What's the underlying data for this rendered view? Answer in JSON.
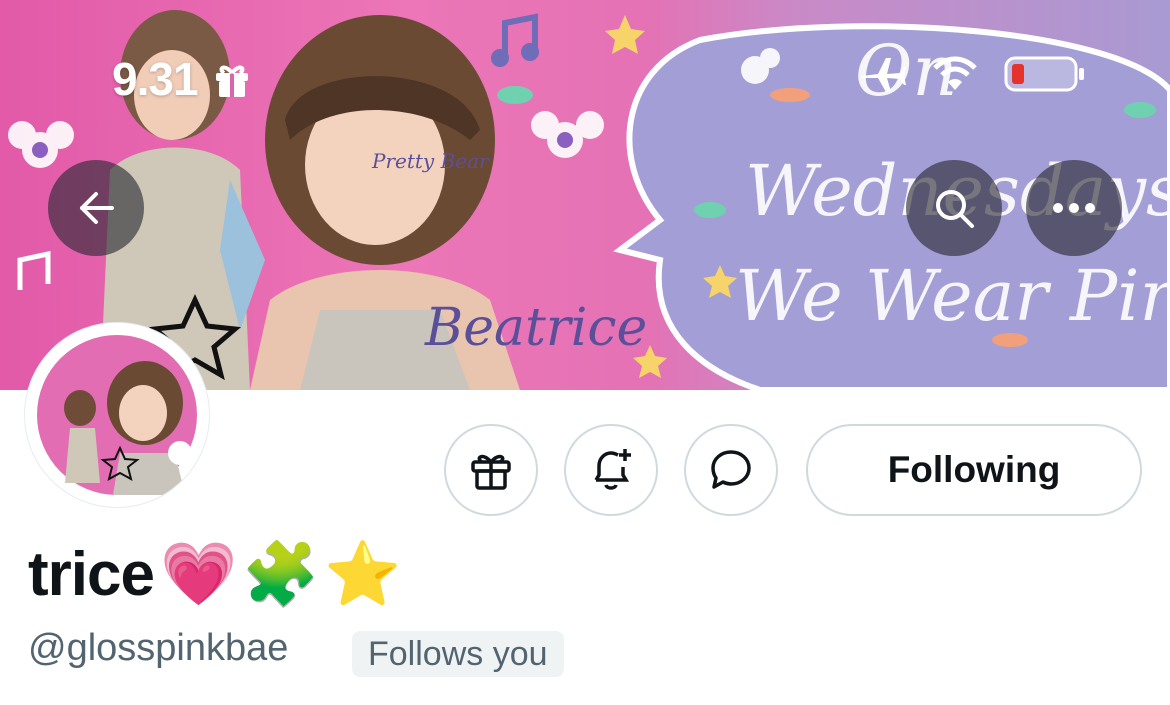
{
  "status_bar": {
    "time": "9.31",
    "icons": [
      "gift-icon",
      "airplane-icon",
      "wifi-icon",
      "battery-icon"
    ]
  },
  "banner": {
    "art_text": {
      "signature": "Beatrice",
      "cheek": "Pretty Bear",
      "bubble_line1": "On",
      "bubble_line2": "Wednesdays",
      "bubble_line3": "We Wear Pink"
    }
  },
  "nav": {
    "back_icon": "arrow-left-icon",
    "search_icon": "search-icon",
    "more_icon": "more-icon"
  },
  "actions": {
    "gift_icon": "gift-icon",
    "notify_icon": "bell-plus-icon",
    "message_icon": "message-icon",
    "following_label": "Following"
  },
  "profile": {
    "display_name": "trice",
    "name_emojis": [
      "💗",
      "🧩",
      "⭐"
    ],
    "handle": "@glosspinkbae",
    "follows_you": "Follows you"
  },
  "colors": {
    "banner_pink": "#e25aa8",
    "bubble_lavender": "#9f9fd6",
    "text_primary": "#0f1419",
    "text_secondary": "#536471",
    "border": "#cfd9de"
  }
}
